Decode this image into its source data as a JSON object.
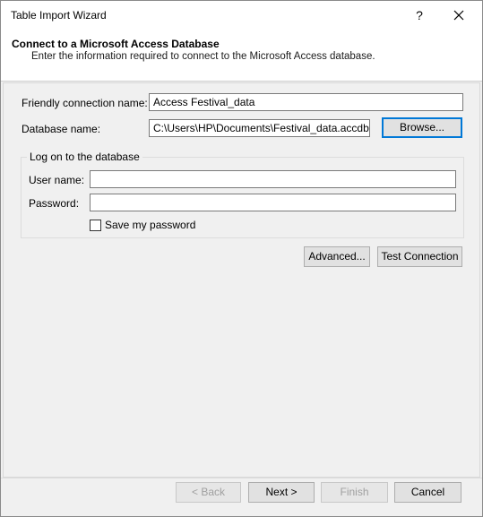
{
  "window": {
    "title": "Table Import Wizard",
    "help_glyph": "?",
    "close_icon": "close-icon"
  },
  "header": {
    "title": "Connect to a Microsoft Access Database",
    "subtitle": "Enter the information required to connect to the Microsoft Access database."
  },
  "form": {
    "friendly_name_label": "Friendly connection name:",
    "friendly_name_value": "Access Festival_data",
    "database_name_label": "Database name:",
    "database_name_value": "C:\\Users\\HP\\Documents\\Festival_data.accdb",
    "browse_label": "Browse...",
    "logon_group_label": "Log on to the database",
    "user_name_label": "User name:",
    "user_name_value": "",
    "password_label": "Password:",
    "password_value": "",
    "save_password_label": "Save my password",
    "save_password_checked": false,
    "advanced_label": "Advanced...",
    "test_connection_label": "Test Connection"
  },
  "footer": {
    "back_label": "< Back",
    "next_label": "Next >",
    "finish_label": "Finish",
    "cancel_label": "Cancel"
  }
}
